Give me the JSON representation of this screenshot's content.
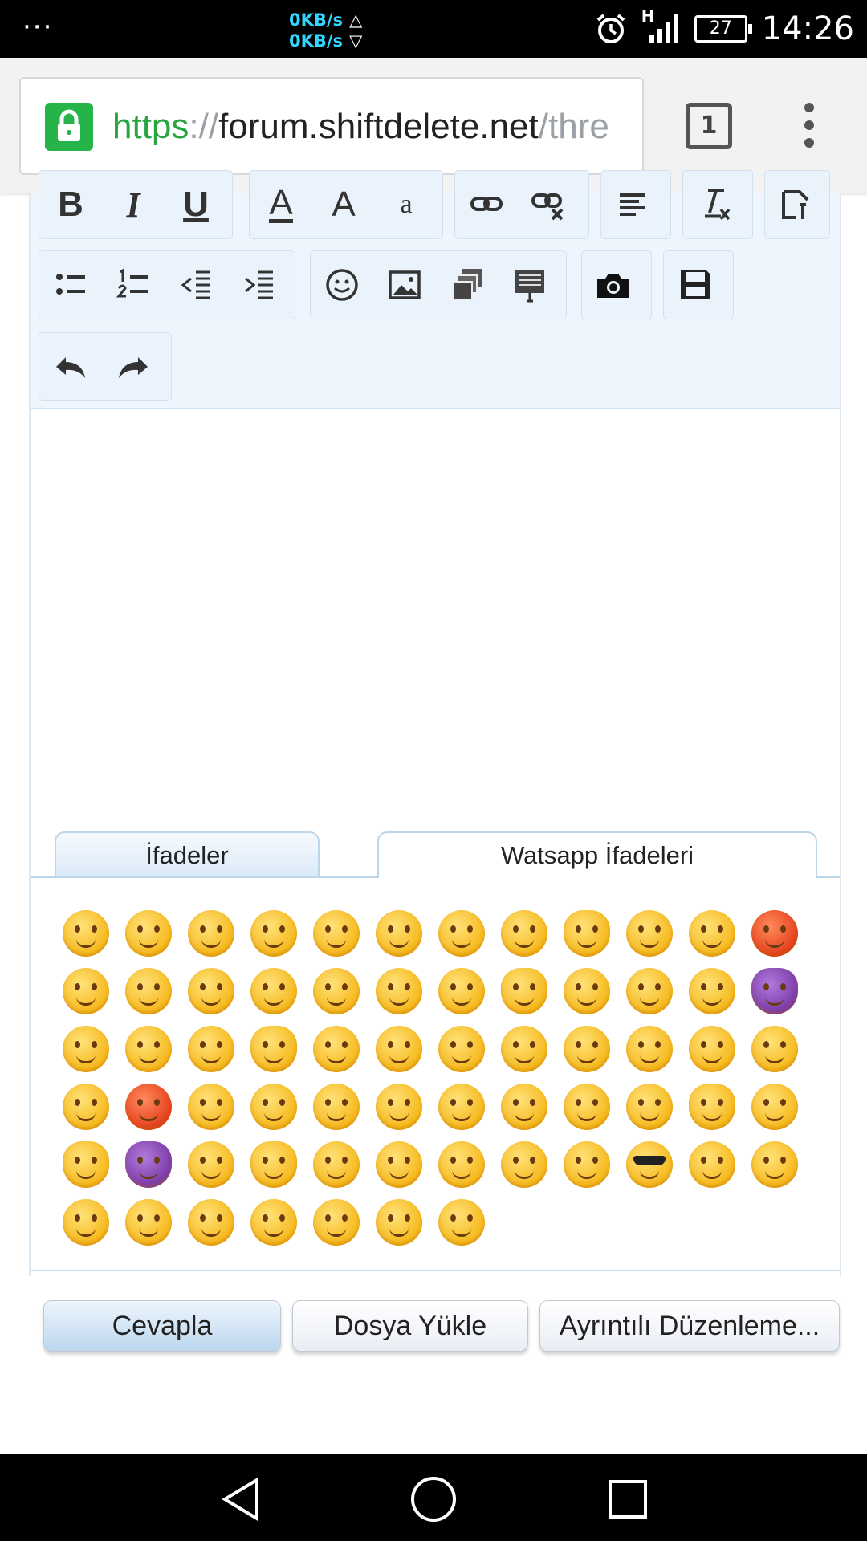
{
  "status_bar": {
    "menu_dots": "···",
    "net_up": "0KB/s",
    "net_down": "0KB/s",
    "up_arrow": "△",
    "down_arrow": "▽",
    "battery": "27",
    "time": "14:26",
    "network_type": "H"
  },
  "browser": {
    "url_scheme": "https",
    "url_sep": "://",
    "url_host": "forum.shiftdelete.net",
    "url_path": "/thre",
    "tab_count": "1"
  },
  "toolbar": {
    "bold": "B",
    "italic": "I",
    "underline": "U",
    "font_color": "A",
    "font_size": "A",
    "font_family": "a"
  },
  "smilies": {
    "tabs": [
      {
        "label": "İfadeler",
        "active": false
      },
      {
        "label": "Watsapp İfadeleri",
        "active": true
      }
    ],
    "count": 67
  },
  "buttons": {
    "reply": "Cevapla",
    "upload": "Dosya Yükle",
    "advanced": "Ayrıntılı Düzenleme..."
  }
}
